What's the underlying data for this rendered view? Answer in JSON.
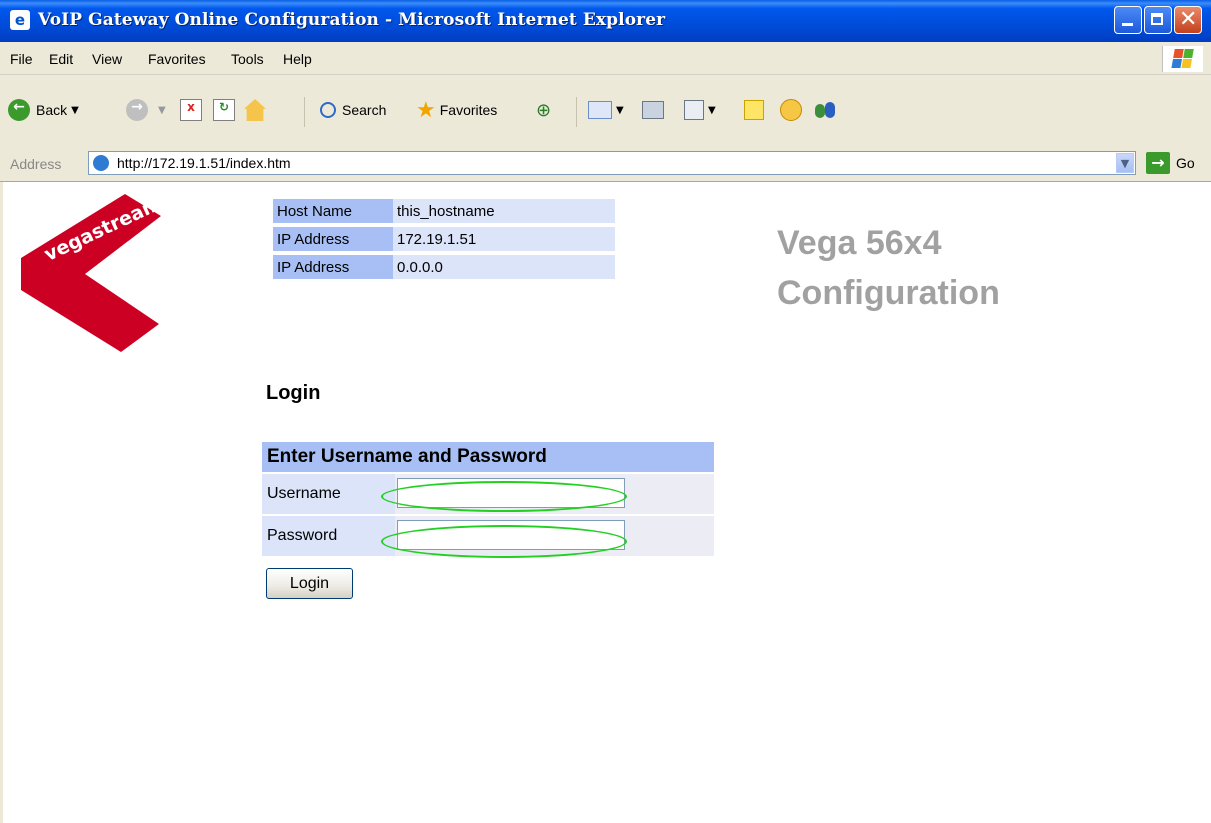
{
  "window": {
    "title": "VoIP Gateway Online Configuration - Microsoft Internet Explorer",
    "icon": "ie-icon"
  },
  "menu": {
    "items": [
      "File",
      "Edit",
      "View",
      "Favorites",
      "Tools",
      "Help"
    ]
  },
  "toolbar": {
    "back": "Back",
    "search": "Search",
    "favorites": "Favorites"
  },
  "address": {
    "label": "Address",
    "url": "http://172.19.1.51/index.htm",
    "go": "Go"
  },
  "page": {
    "logo_text": "vegastream",
    "logo_color": "#CC0022",
    "info": [
      {
        "label": "Host Name",
        "value": "this_hostname"
      },
      {
        "label": "IP Address",
        "value": "172.19.1.51"
      },
      {
        "label": "IP Address",
        "value": "0.0.0.0"
      }
    ],
    "title_line1": "Vega 56x4",
    "title_line2": "Configuration",
    "login_heading": "Login",
    "form": {
      "header": "Enter Username and Password",
      "username_label": "Username",
      "username_value": "",
      "password_label": "Password",
      "password_value": ""
    },
    "login_button": "Login"
  },
  "colors": {
    "header_blue": "#A7BFF4",
    "row_light_blue": "#DCE4FA",
    "highlight_green": "#22D022",
    "title_gray": "#A1A1A1"
  }
}
